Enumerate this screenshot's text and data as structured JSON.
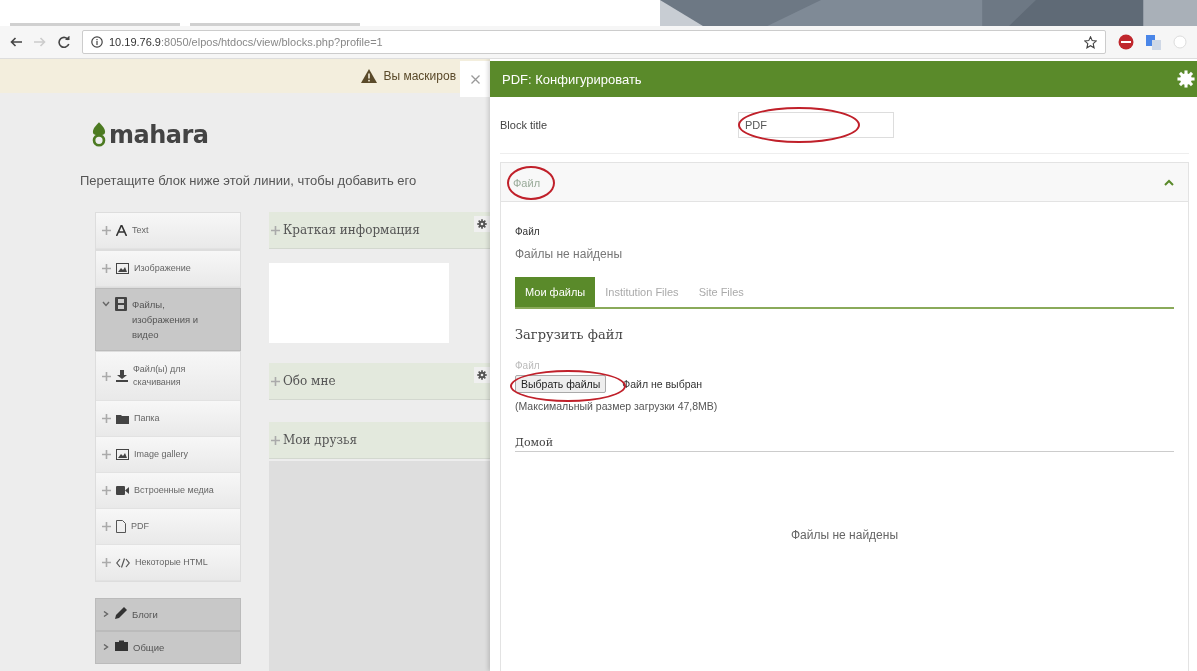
{
  "browser": {
    "url_host": "10.19.76.9",
    "url_rest": ":8050/elpos/htdocs/view/blocks.php?profile=1"
  },
  "masquerade_banner": {
    "text": "Вы маскиров"
  },
  "page": {
    "logo": "mahara",
    "instruction": "Перетащите блок ниже этой линии, чтобы добавить его",
    "block_types": [
      {
        "kind": "item",
        "label": "Text"
      },
      {
        "kind": "item",
        "label": "Изображение"
      },
      {
        "kind": "category",
        "label": "Файлы, изображения и видео",
        "expanded": true,
        "children": [
          {
            "kind": "item",
            "label": "Файл(ы) для скачивания"
          },
          {
            "kind": "item",
            "label": "Папка"
          },
          {
            "kind": "item",
            "label": "Image gallery"
          },
          {
            "kind": "item",
            "label": "Встроенные медиа"
          },
          {
            "kind": "item",
            "label": "PDF"
          },
          {
            "kind": "item",
            "label": "Некоторые HTML"
          }
        ]
      },
      {
        "kind": "category",
        "label": "Блоги",
        "expanded": false
      },
      {
        "kind": "category",
        "label": "Общие",
        "expanded": false
      }
    ],
    "blocks": [
      {
        "title": "Краткая информация",
        "settings": true,
        "kind": "card"
      },
      {
        "title": "Обо мне",
        "settings": true,
        "kind": "plain"
      },
      {
        "title": "Мои друзья",
        "settings": false,
        "kind": "list"
      }
    ]
  },
  "drawer": {
    "title": "PDF: Конфигурировать",
    "block_title": {
      "label": "Block title",
      "value": "PDF",
      "circled": true
    },
    "section": {
      "title": "Файл",
      "expanded": true,
      "circled": true,
      "file_label": "Файл",
      "no_files": "Файлы не найдены",
      "tabs": [
        {
          "label": "Мои файлы",
          "selected": true
        },
        {
          "label": "Institution Files",
          "selected": false
        },
        {
          "label": "Site Files",
          "selected": false
        }
      ],
      "upload_heading": "Загрузить файл",
      "upload_label": "Файл",
      "choose_button": {
        "label": "Выбрать файлы",
        "circled": true
      },
      "no_file_chosen": "Файл не выбран",
      "max_size": "(Максимальный размер загрузки 47,8MB)",
      "folder_heading": "Домой",
      "folder_empty": "Файлы не найдены"
    }
  }
}
